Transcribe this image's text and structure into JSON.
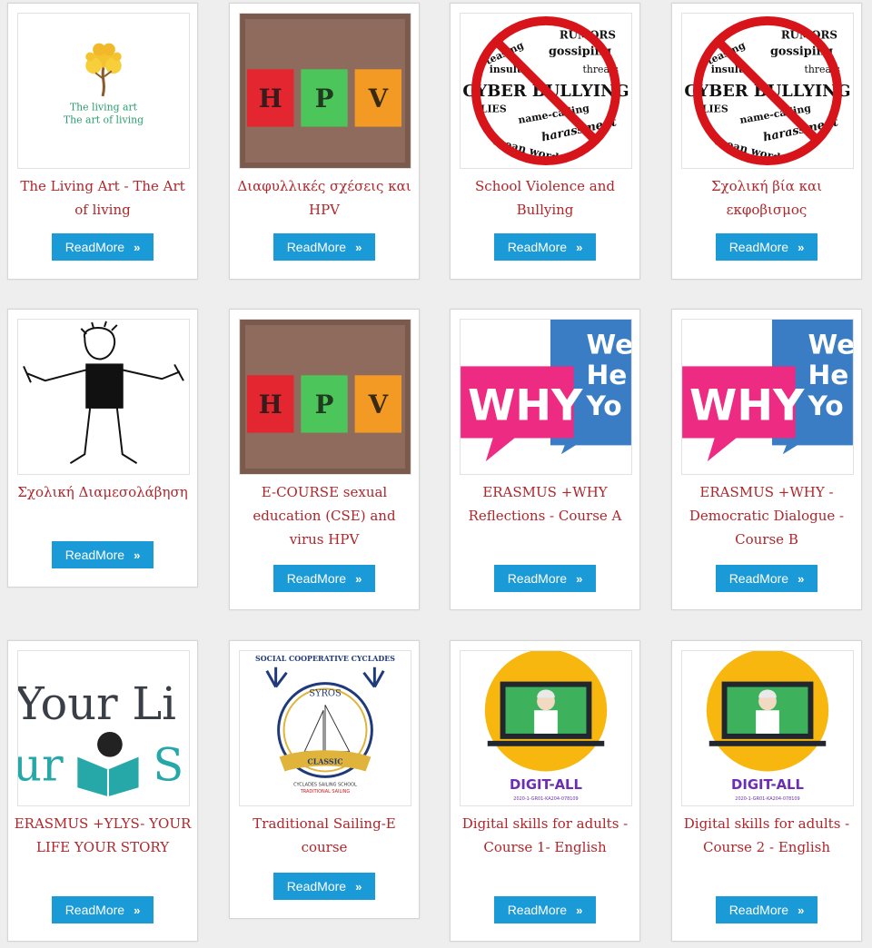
{
  "ui": {
    "readmore_label": "ReadMore",
    "chevron": "»"
  },
  "images": {
    "living_art": {
      "line1": "The living art",
      "line2": "The art of living"
    },
    "hpv": {
      "h": "H",
      "p": "P",
      "v": "V"
    },
    "bullying": {
      "w1": "RUMORS",
      "w2": "teasing",
      "w3": "gossiping",
      "w4": "insults",
      "w5": "threats",
      "w6": "CYBER BULLYING",
      "w7": "LIES",
      "w8": "name-calling",
      "w9": "harassment",
      "w10": "mean words"
    },
    "why": {
      "why": "WHY",
      "we": "We",
      "he": "He",
      "yo": "Yo"
    },
    "ylys": {
      "t1": "Your Li",
      "t2": "ur",
      "t3": "S"
    },
    "sailing": {
      "top": "SOCIAL COOPERATIVE CYCLADES",
      "syros": "SYROS",
      "ribbon": "CLASSIC",
      "sub1": "CYCLADES SAILING SCHOOL",
      "sub2": "TRADITIONAL SAILING"
    },
    "digit": {
      "brand": "DIGIT-ALL",
      "code": "2020-1-GR01-KA204-078109"
    }
  },
  "courses": [
    {
      "title": "The Living Art - The Art of living",
      "image": "living-art"
    },
    {
      "title": "Διαφυλλικές σχέσεις και HPV",
      "image": "hpv"
    },
    {
      "title": "School Violence and Bullying",
      "image": "bullying"
    },
    {
      "title": "Σχολική βία και εκφοβισμος",
      "image": "bullying"
    },
    {
      "title": "Σχολική Διαμεσολάβηση",
      "image": "mediation"
    },
    {
      "title": "E-COURSE sexual education (CSE) and virus HPV",
      "image": "hpv"
    },
    {
      "title": "ERASMUS +WHY Reflections - Course A",
      "image": "why"
    },
    {
      "title": "ERASMUS +WHY - Democratic Dialogue - Course B",
      "image": "why"
    },
    {
      "title": "ERASMUS +YLYS- YOUR LIFE YOUR STORY",
      "image": "ylys"
    },
    {
      "title": "Traditional Sailing-E course",
      "image": "sailing"
    },
    {
      "title": "Digital skills for adults - Course 1- English",
      "image": "digit-all"
    },
    {
      "title": "Digital skills for adults - Course 2 - English",
      "image": "digit-all"
    }
  ]
}
